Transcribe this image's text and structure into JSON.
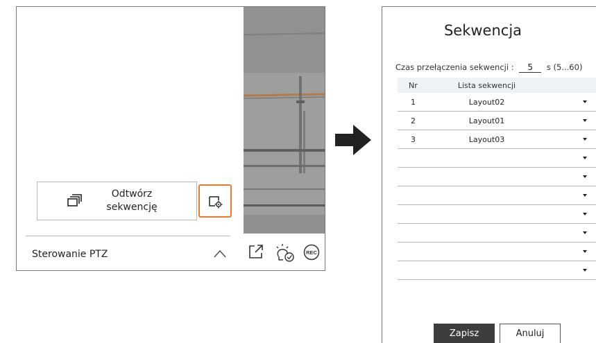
{
  "left_panel": {
    "play_sequence_label": "Odtwórz\nsekwencję",
    "ptz_label": "Sterowanie PTZ",
    "icons": {
      "sequence": "sequence-layers-icon",
      "settings": "sequence-settings-icon",
      "chevron": "chevron-up-icon",
      "popout": "popout-icon",
      "event": "event-check-icon",
      "rec": "rec-icon"
    },
    "rec_text": "REC",
    "highlight_color": "#ec7a2d"
  },
  "dialog": {
    "title": "Sekwencja",
    "switch_label": "Czas przełączenia sekwencji :",
    "switch_value": "5",
    "switch_unit": "s (5...60)",
    "columns": {
      "nr": "Nr",
      "list": "Lista sekwencji"
    },
    "rows": [
      {
        "nr": "1",
        "layout": "Layout02"
      },
      {
        "nr": "2",
        "layout": "Layout01"
      },
      {
        "nr": "3",
        "layout": "Layout03"
      },
      {
        "nr": "",
        "layout": ""
      },
      {
        "nr": "",
        "layout": ""
      },
      {
        "nr": "",
        "layout": ""
      },
      {
        "nr": "",
        "layout": ""
      },
      {
        "nr": "",
        "layout": ""
      },
      {
        "nr": "",
        "layout": ""
      },
      {
        "nr": "",
        "layout": ""
      }
    ],
    "save_label": "Zapisz",
    "cancel_label": "Anuluj"
  }
}
